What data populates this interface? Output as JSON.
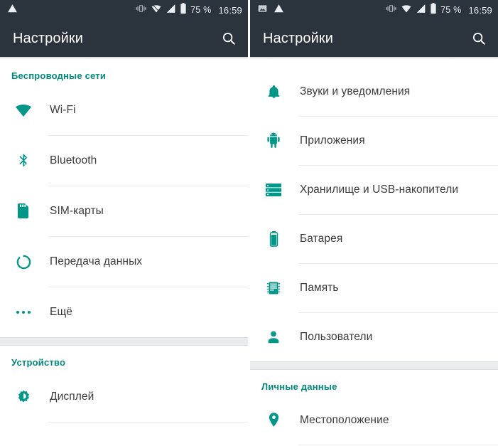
{
  "colors": {
    "accent": "#009688",
    "section_header": "#00897b",
    "toolbar_bg": "#2b333c",
    "statusbar_bg": "#2b333c",
    "label": "#3b3b3b",
    "divider": "#ececec",
    "page_bg": "#ffffff"
  },
  "left_screen": {
    "statusbar": {
      "left_icons": [
        "warning-triangle-icon"
      ],
      "right_icons": [
        "vibrate-icon",
        "wifi-icon",
        "cell-signal-icon",
        "battery-icon"
      ],
      "battery_percent": "75 %",
      "clock": "16:59"
    },
    "toolbar": {
      "title": "Настройки",
      "search_icon": "search-icon"
    },
    "sections": [
      {
        "header": "Беспроводные сети",
        "items": [
          {
            "icon": "wifi-icon",
            "label": "Wi-Fi"
          },
          {
            "icon": "bluetooth-icon",
            "label": "Bluetooth"
          },
          {
            "icon": "sim-card-icon",
            "label": "SIM-карты"
          },
          {
            "icon": "data-usage-icon",
            "label": "Передача данных"
          },
          {
            "icon": "more-horizontal-icon",
            "label": "Ещё"
          }
        ]
      },
      {
        "header": "Устройство",
        "items": [
          {
            "icon": "display-brightness-icon",
            "label": "Дисплей"
          }
        ]
      }
    ]
  },
  "right_screen": {
    "statusbar": {
      "left_icons": [
        "image-icon",
        "warning-triangle-icon"
      ],
      "right_icons": [
        "vibrate-icon",
        "wifi-icon",
        "cell-signal-icon",
        "battery-icon"
      ],
      "battery_percent": "75 %",
      "clock": "16:59"
    },
    "toolbar": {
      "title": "Настройки",
      "search_icon": "search-icon"
    },
    "sections": [
      {
        "header": "",
        "items": [
          {
            "icon": "bell-icon",
            "label": "Звуки и уведомления"
          },
          {
            "icon": "android-robot-icon",
            "label": "Приложения"
          },
          {
            "icon": "storage-icon",
            "label": "Хранилище и USB-накопители"
          },
          {
            "icon": "battery-icon",
            "label": "Батарея"
          },
          {
            "icon": "memory-chip-icon",
            "label": "Память"
          },
          {
            "icon": "person-icon",
            "label": "Пользователи"
          }
        ]
      },
      {
        "header": "Личные данные",
        "items": [
          {
            "icon": "location-pin-icon",
            "label": "Местоположение"
          }
        ]
      }
    ]
  }
}
